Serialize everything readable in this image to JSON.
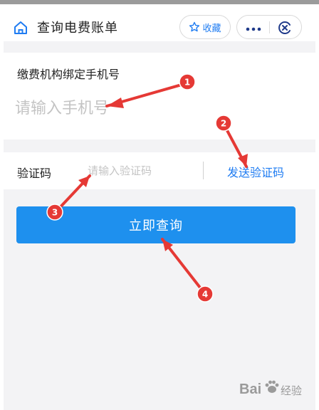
{
  "header": {
    "title": "查询电费账单",
    "favorite_label": "收藏",
    "accent_color": "#1f7cf2"
  },
  "form": {
    "phone_label": "缴费机构绑定手机号",
    "phone_placeholder": "请输入手机号",
    "code_label": "验证码",
    "code_placeholder": "请输入验证码",
    "send_code_label": "发送验证码"
  },
  "actions": {
    "query_label": "立即查询",
    "query_color": "#1e90ee"
  },
  "annotations": {
    "badges": [
      "1",
      "2",
      "3",
      "4"
    ],
    "color": "#e53935"
  },
  "icons": [
    "home-icon",
    "star-icon",
    "more-icon",
    "close-icon"
  ],
  "watermark": {
    "brand": "Bai",
    "text": "经验"
  }
}
